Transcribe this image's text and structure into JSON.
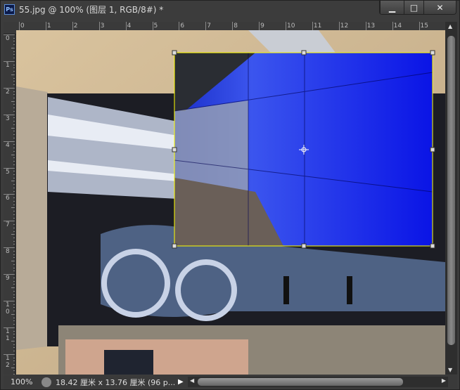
{
  "window": {
    "title": "55.jpg @ 100% (图层 1, RGB/8#) *",
    "app_icon": "Ps",
    "controls": [
      "minimize",
      "maximize",
      "close"
    ]
  },
  "ruler": {
    "horizontal": [
      "0",
      "1",
      "2",
      "3",
      "4",
      "5",
      "6",
      "7",
      "8",
      "9",
      "10",
      "11",
      "12",
      "13",
      "14",
      "15"
    ],
    "vertical": [
      "0",
      "1",
      "2",
      "3",
      "4",
      "5",
      "6",
      "7",
      "8",
      "9",
      "1\n0",
      "1\n1",
      "1\n2"
    ],
    "unit": "厘米"
  },
  "status": {
    "zoom": "100%",
    "doc_info": "18.42 厘米 x 13.76 厘米 (96 p..."
  },
  "colors": {
    "selection_fill": "#0a14e6",
    "transform_border": "#ffff00"
  }
}
